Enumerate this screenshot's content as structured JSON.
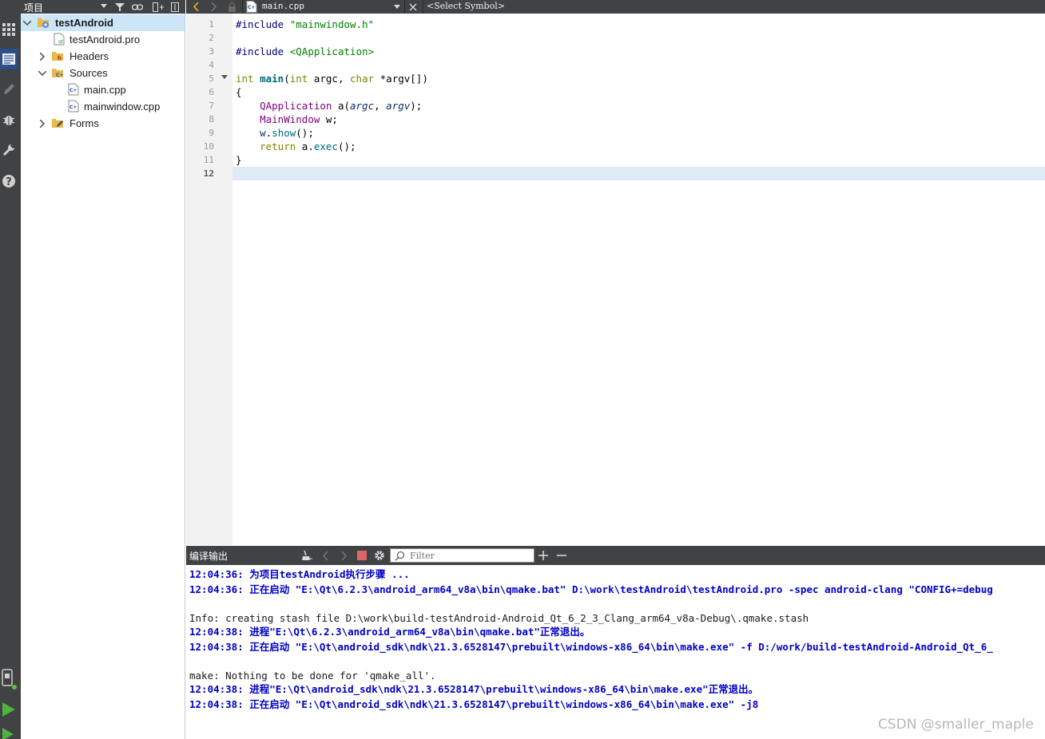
{
  "project_panel": {
    "title": "项目",
    "tree": [
      {
        "label": "testAndroid",
        "kind": "project",
        "expanded": true,
        "selected": true
      },
      {
        "label": "testAndroid.pro",
        "kind": "pro-file"
      },
      {
        "label": "Headers",
        "kind": "folder",
        "expanded": false
      },
      {
        "label": "Sources",
        "kind": "folder",
        "expanded": true
      },
      {
        "label": "main.cpp",
        "kind": "cpp-file"
      },
      {
        "label": "mainwindow.cpp",
        "kind": "cpp-file"
      },
      {
        "label": "Forms",
        "kind": "folder",
        "expanded": false
      }
    ]
  },
  "editor": {
    "filename": "main.cpp",
    "symbol": "<Select Symbol>",
    "current_line": "12",
    "line_numbers": [
      "1",
      "2",
      "3",
      "4",
      "5",
      "6",
      "7",
      "8",
      "9",
      "10",
      "11",
      "12"
    ],
    "lines": [
      "#include \"mainwindow.h\"",
      "",
      "#include <QApplication>",
      "",
      "int main(int argc, char *argv[])",
      "{",
      "    QApplication a(argc, argv);",
      "    MainWindow w;",
      "    w.show();",
      "    return a.exec();",
      "}",
      ""
    ]
  },
  "output": {
    "title": "编译输出",
    "filter_placeholder": "Filter",
    "lines": [
      {
        "text": "12:04:36: 为项目testAndroid执行步骤 ...",
        "style": "blue"
      },
      {
        "text": "12:04:36: 正在启动 \"E:\\Qt\\6.2.3\\android_arm64_v8a\\bin\\qmake.bat\" D:\\work\\testAndroid\\testAndroid.pro -spec android-clang \"CONFIG+=debug",
        "style": "blue"
      },
      {
        "text": "",
        "style": "plain"
      },
      {
        "text": "Info: creating stash file D:\\work\\build-testAndroid-Android_Qt_6_2_3_Clang_arm64_v8a-Debug\\.qmake.stash",
        "style": "plain"
      },
      {
        "text": "12:04:38: 进程\"E:\\Qt\\6.2.3\\android_arm64_v8a\\bin\\qmake.bat\"正常退出。",
        "style": "blue"
      },
      {
        "text": "12:04:38: 正在启动 \"E:\\Qt\\android_sdk\\ndk\\21.3.6528147\\prebuilt\\windows-x86_64\\bin\\make.exe\" -f D:/work/build-testAndroid-Android_Qt_6_",
        "style": "blue"
      },
      {
        "text": "",
        "style": "plain"
      },
      {
        "text": "make: Nothing to be done for 'qmake_all'.",
        "style": "plain"
      },
      {
        "text": "12:04:38: 进程\"E:\\Qt\\android_sdk\\ndk\\21.3.6528147\\prebuilt\\windows-x86_64\\bin\\make.exe\"正常退出。",
        "style": "blue"
      },
      {
        "text": "12:04:38: 正在启动 \"E:\\Qt\\android_sdk\\ndk\\21.3.6528147\\prebuilt\\windows-x86_64\\bin\\make.exe\" -j8",
        "style": "blue"
      }
    ]
  },
  "watermark": "CSDN @smaller_maple",
  "colors": {
    "toolbar_bg": "#404244",
    "selection_bg": "#cde6f7",
    "current_line_bg": "#dfeaf7",
    "output_blue": "#0000c8",
    "keyword": "#808000",
    "preprocessor": "#000080",
    "string": "#008000",
    "type": "#800080"
  }
}
